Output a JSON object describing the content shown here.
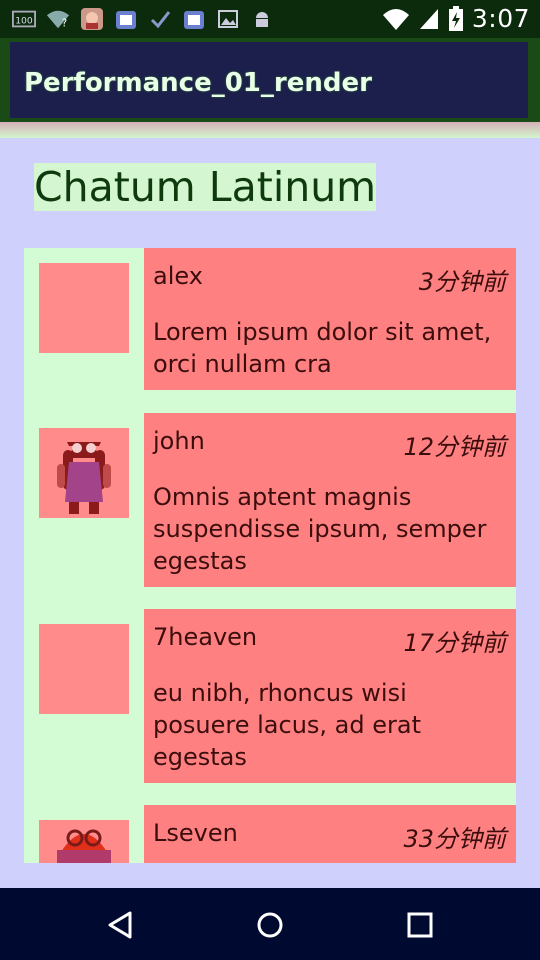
{
  "status_bar": {
    "time": "3:07",
    "badge": "100"
  },
  "toolbar": {
    "title": "Performance_01_render"
  },
  "header": {
    "title": "Chatum Latinum"
  },
  "messages": [
    {
      "name": "alex",
      "time": "3分钟前",
      "text": "Lorem ipsum dolor sit amet, orci nullam cra",
      "avatar": "blank"
    },
    {
      "name": "john",
      "time": "12分钟前",
      "text": "Omnis aptent magnis suspendisse ipsum, semper egestas",
      "avatar": "android-girl"
    },
    {
      "name": "7heaven",
      "time": "17分钟前",
      "text": "eu nibh, rhoncus wisi posuere lacus, ad erat egestas",
      "avatar": "blank"
    },
    {
      "name": "Lseven",
      "time": "33分钟前",
      "text": "",
      "avatar": "android-glasses"
    }
  ],
  "colors": {
    "overdraw_blue": "#d0d0fc",
    "overdraw_green": "#d4fcd4",
    "overdraw_red": "#ff8080"
  },
  "nav": {
    "back": "back-icon",
    "home": "home-icon",
    "recents": "recents-icon"
  }
}
